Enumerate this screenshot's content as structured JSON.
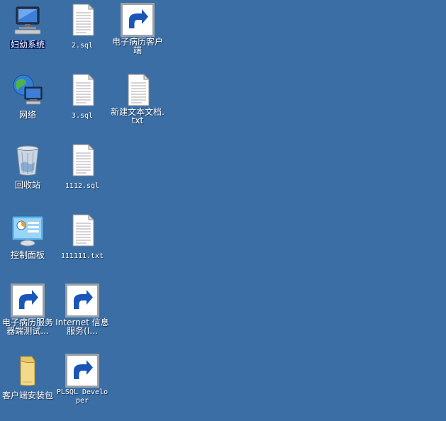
{
  "desktop": {
    "background_color": "#3a6ea5",
    "icons": {
      "fuyou": "妇幼系统",
      "sql2": "2.sql",
      "emr_client": "电子病历客户端",
      "network": "网络",
      "sql3": "3.sql",
      "new_text": "新建文本文档.txt",
      "recycle": "回收站",
      "sql1112": "1112.sql",
      "control_panel": "控制面板",
      "txt111111": "111111.txt",
      "emr_test": "电子病历服务器端测试...",
      "iis": "Internet 信息服务(I...",
      "client_pkg": "客户端安装包",
      "plsql": "PLSQL Developer"
    }
  }
}
